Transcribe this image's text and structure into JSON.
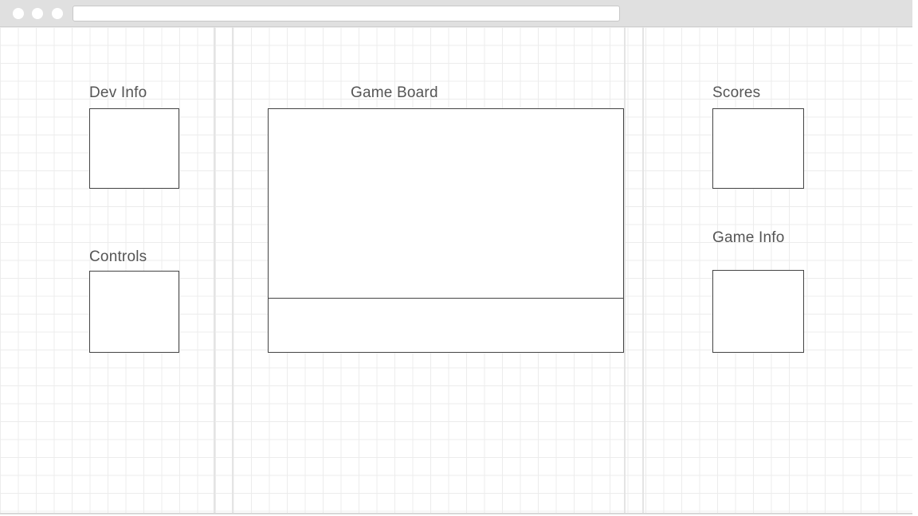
{
  "browser": {
    "address_value": ""
  },
  "panels": {
    "dev_info": {
      "label": "Dev Info"
    },
    "controls": {
      "label": "Controls"
    },
    "game_board": {
      "label": "Game Board"
    },
    "scores": {
      "label": "Scores"
    },
    "game_info": {
      "label": "Game Info"
    }
  }
}
